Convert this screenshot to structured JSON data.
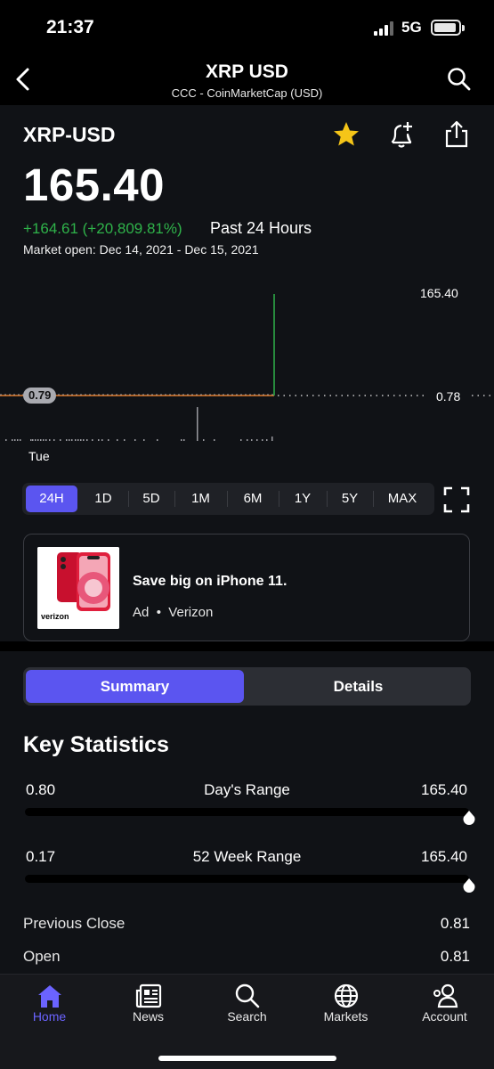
{
  "status": {
    "time": "21:37",
    "network": "5G"
  },
  "nav": {
    "title": "XRP USD",
    "subtitle": "CCC - CoinMarketCap (USD)"
  },
  "quote": {
    "ticker": "XRP-USD",
    "price": "165.40",
    "change": "+164.61 (+20,809.81%)",
    "change_period": "Past 24 Hours",
    "market_open": "Market open: Dec 14, 2021 - Dec 15, 2021"
  },
  "chart": {
    "high_label": "165.40",
    "prev_close_badge": "0.79",
    "baseline_label": "0.78",
    "x_label": "Tue"
  },
  "chart_data": {
    "type": "line",
    "x_tick_labels": [
      "Tue"
    ],
    "y_labels": [
      "165.40",
      "0.78"
    ],
    "prev_close": 0.79,
    "series": [
      {
        "values": [
          0.79,
          0.79,
          0.79,
          0.79,
          0.79,
          0.79,
          0.79,
          0.79,
          0.79,
          0.79,
          0.79,
          165.4
        ]
      }
    ],
    "colors": {
      "flat": "#e07a2a",
      "spike": "#2fb34a"
    }
  },
  "ranges": {
    "items": [
      "24H",
      "1D",
      "5D",
      "1M",
      "6M",
      "1Y",
      "5Y",
      "MAX"
    ],
    "active": "24H"
  },
  "ad": {
    "title": "Save big on iPhone 11.",
    "label": "Ad",
    "sponsor": "Verizon",
    "image_text": "verizon"
  },
  "tabs_segment": {
    "summary": "Summary",
    "details": "Details"
  },
  "stats": {
    "title": "Key Statistics",
    "day_range": {
      "low": "0.80",
      "label": "Day's Range",
      "high": "165.40",
      "position": 1.0
    },
    "week52_range": {
      "low": "0.17",
      "label": "52 Week Range",
      "high": "165.40",
      "position": 1.0
    },
    "rows": [
      {
        "label": "Previous Close",
        "value": "0.81"
      },
      {
        "label": "Open",
        "value": "0.81"
      }
    ]
  },
  "tabbar": {
    "items": [
      {
        "label": "Home",
        "icon": "home-icon"
      },
      {
        "label": "News",
        "icon": "news-icon"
      },
      {
        "label": "Search",
        "icon": "search-icon"
      },
      {
        "label": "Markets",
        "icon": "globe-icon"
      },
      {
        "label": "Account",
        "icon": "account-icon"
      }
    ],
    "active": "Home"
  },
  "colors": {
    "accent": "#5b55f0",
    "positive": "#2fb34a",
    "star": "#f5c518",
    "background": "#101216"
  }
}
